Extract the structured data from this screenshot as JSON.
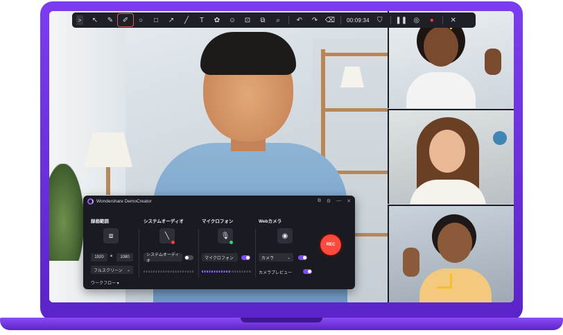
{
  "toolbar": {
    "collapse_label": ">",
    "tools": [
      {
        "name": "cursor-icon",
        "glyph": "↖"
      },
      {
        "name": "pen-icon",
        "glyph": "✎"
      },
      {
        "name": "highlighter-icon",
        "glyph": "✐"
      },
      {
        "name": "circle-icon",
        "glyph": "○"
      },
      {
        "name": "rectangle-icon",
        "glyph": "□"
      },
      {
        "name": "arrow-icon",
        "glyph": "↗"
      },
      {
        "name": "line-icon",
        "glyph": "╱"
      },
      {
        "name": "text-icon",
        "glyph": "T"
      },
      {
        "name": "effects-icon",
        "glyph": "✿"
      },
      {
        "name": "sticker-icon",
        "glyph": "☺"
      },
      {
        "name": "spotlight-icon",
        "glyph": "⊡"
      },
      {
        "name": "screenshot-icon",
        "glyph": "⧉"
      },
      {
        "name": "zoom-icon",
        "glyph": "⌕"
      }
    ],
    "undo_glyph": "↶",
    "redo_glyph": "↷",
    "clear_glyph": "⌫",
    "timer": "00:09:34",
    "shield_glyph": "⛉",
    "pause_glyph": "❚❚",
    "target_glyph": "◎",
    "record_glyph": "●",
    "close_glyph": "✕"
  },
  "panel": {
    "title": "Wondershare DemoCreator",
    "header_icons": [
      "⧉",
      "⚙",
      "—",
      "✕"
    ],
    "sections": {
      "screen": {
        "label": "録画範囲",
        "width": "1920",
        "height": "1080",
        "mode": "フルスクリーン"
      },
      "system_audio": {
        "label": "システムオーディオ",
        "select": "システムオーディオ"
      },
      "microphone": {
        "label": "マイクロフォン",
        "select": "マイクロフォン"
      },
      "webcam": {
        "label": "Webカメラ",
        "select": "カメラ",
        "preview_label": "カメラプレビュー"
      }
    },
    "workflow_label": "ワークフロー ▾",
    "rec_label": "REC"
  },
  "colors": {
    "accent": "#7c4dff",
    "record": "#ff3b3b",
    "frame": "#6a2fe0"
  }
}
